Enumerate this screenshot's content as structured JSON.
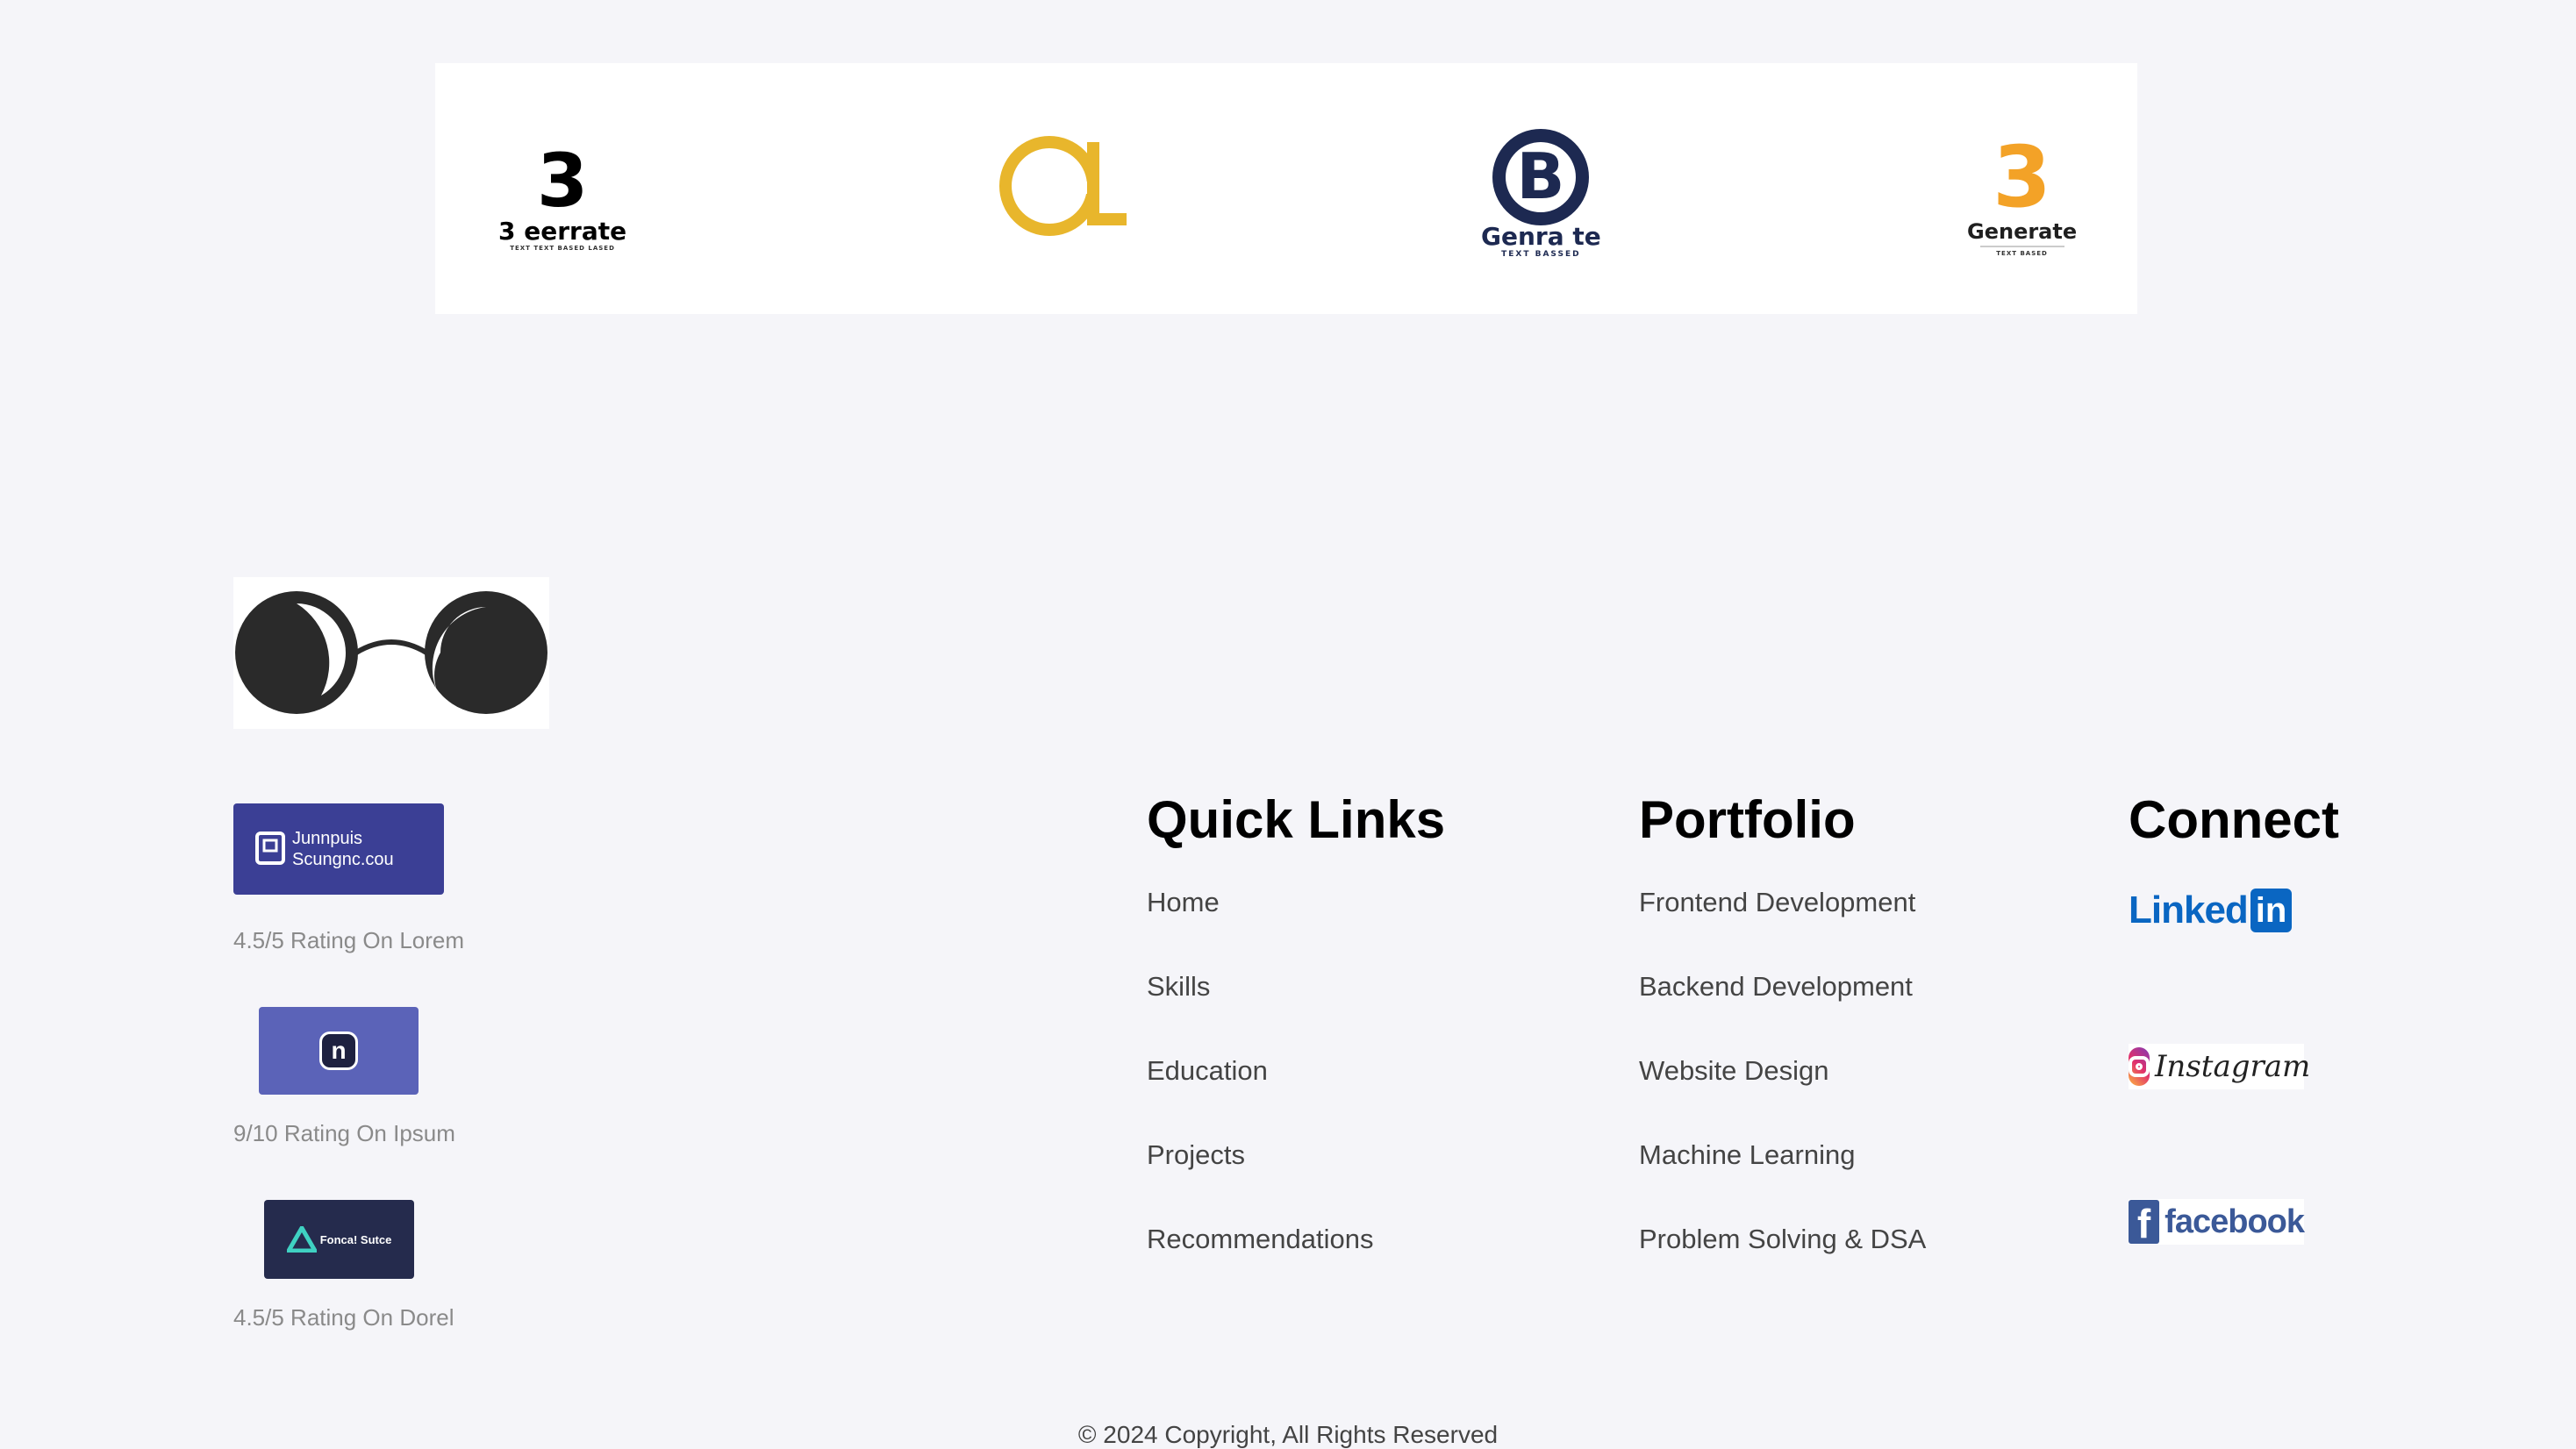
{
  "partners": [
    {
      "mark": "3",
      "word": "3 eerrate",
      "tag": "TEXT TEXT BASED LASED"
    },
    {
      "mark": "GL",
      "word": "",
      "tag": ""
    },
    {
      "mark": "B",
      "word": "Genra te",
      "tag": "TEXT BASSED"
    },
    {
      "mark": "3",
      "word": "Generate",
      "tag": "TEXT BASED"
    }
  ],
  "colors": {
    "background": "#f5f5f9",
    "badge1": "#3b3f95",
    "badge2": "#5b63b8",
    "badge3": "#252b4d",
    "gold": "#e8b62c",
    "navy": "#1d2951",
    "orange": "#f3a227",
    "linkedin": "#0a66c2",
    "facebook": "#3b5998"
  },
  "ratings": [
    {
      "badge_text": "Junnpuis Scungnc.cou",
      "label": "4.5/5 Rating On Lorem",
      "icon": "card-logo-icon"
    },
    {
      "badge_text": "n",
      "label": "9/10 Rating On Ipsum",
      "icon": "n-logo-icon"
    },
    {
      "badge_text": "Fonca! Sutce",
      "label": "4.5/5 Rating On Dorel",
      "icon": "triangle-logo-icon"
    }
  ],
  "quick_links": {
    "title": "Quick Links",
    "items": [
      "Home",
      "Skills",
      "Education",
      "Projects",
      "Recommendations"
    ]
  },
  "portfolio": {
    "title": "Portfolio",
    "items": [
      "Frontend Development",
      "Backend Development",
      "Website Design",
      "Machine Learning",
      "Problem Solving & DSA"
    ]
  },
  "connect": {
    "title": "Connect",
    "linkedin": {
      "text": "Linked",
      "badge": "in"
    },
    "instagram": {
      "text": "Instagram"
    },
    "facebook": {
      "text": "facebook"
    }
  },
  "footer": {
    "copyright": "© 2024 Copyright, All Rights Reserved"
  }
}
